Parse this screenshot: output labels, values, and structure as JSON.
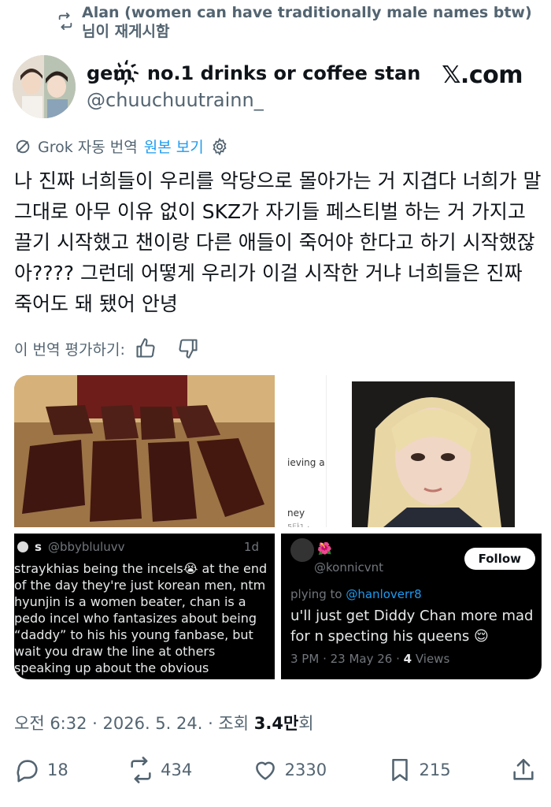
{
  "repost": {
    "line1": "Alan (women can have traditionally male names btw)",
    "line2": "님이 재게시함"
  },
  "author": {
    "display_name": "gem҉ no.1 drinks or coffee stan",
    "handle": "@chuuchuutrainn_"
  },
  "brand": {
    "logo": "𝕏.com"
  },
  "translate": {
    "label": "Grok 자동 번역",
    "show_original": "원본 보기"
  },
  "tweet": {
    "text": "나 진짜 너희들이 우리를 악당으로 몰아가는 거 지겹다 너희가 말 그대로 아무 이유 없이 SKZ가 자기들 페스티벌 하는 거 가지고 끌기 시작했고 챈이랑 다른 애들이 죽어야 한다고 하기 시작했잖아???? 그런데 어떻게 우리가 이걸 시작한 거냐 너희들은 진짜 죽어도 돼 됐어 안녕"
  },
  "rate": {
    "label": "이 번역 평가하기:"
  },
  "media": {
    "screenshot1": {
      "snippet_a": "ieving a",
      "snippet_b": "ney",
      "snippet_c": "5타1 · ."
    },
    "tweet1": {
      "user": "s",
      "handle": "@bbybluluvv",
      "age": "1d",
      "text": "straykhias being the incels😭 at the end of the day they're just korean men, ntm hyunjin is a women beater, chan is a pedo incel who fantasizes about being “daddy” to his his young fanbase, but wait you draw the line at others speaking up about the obvious misogyny happening?"
    },
    "tweet2": {
      "emoji": "🌺",
      "handle": "@konnicvnt",
      "follow": "Follow",
      "replying_prefix": "plying to ",
      "replying_handle": "@hanloverr8",
      "text": "u'll just get Diddy Chan more mad for n specting his queens 😌",
      "meta_prefix": "3 PM · 23 May 26 · ",
      "views_count": "4",
      "views_label": " Views"
    }
  },
  "timestamp": {
    "time": "오전 6:32 · 2026. 5. 24. · 조회 ",
    "views": "3.4만",
    "suffix": "회"
  },
  "actions": {
    "replies": "18",
    "reposts": "434",
    "likes": "2330",
    "bookmarks": "215"
  },
  "colors": {
    "secondary_text": "#536471",
    "link": "#1d9bf0",
    "text": "#0f1419"
  },
  "icons": [
    "repost-icon",
    "grok-icon",
    "gear-icon",
    "thumbs-up-icon",
    "thumbs-down-icon",
    "reply-icon",
    "like-icon",
    "bookmark-icon",
    "share-icon"
  ]
}
